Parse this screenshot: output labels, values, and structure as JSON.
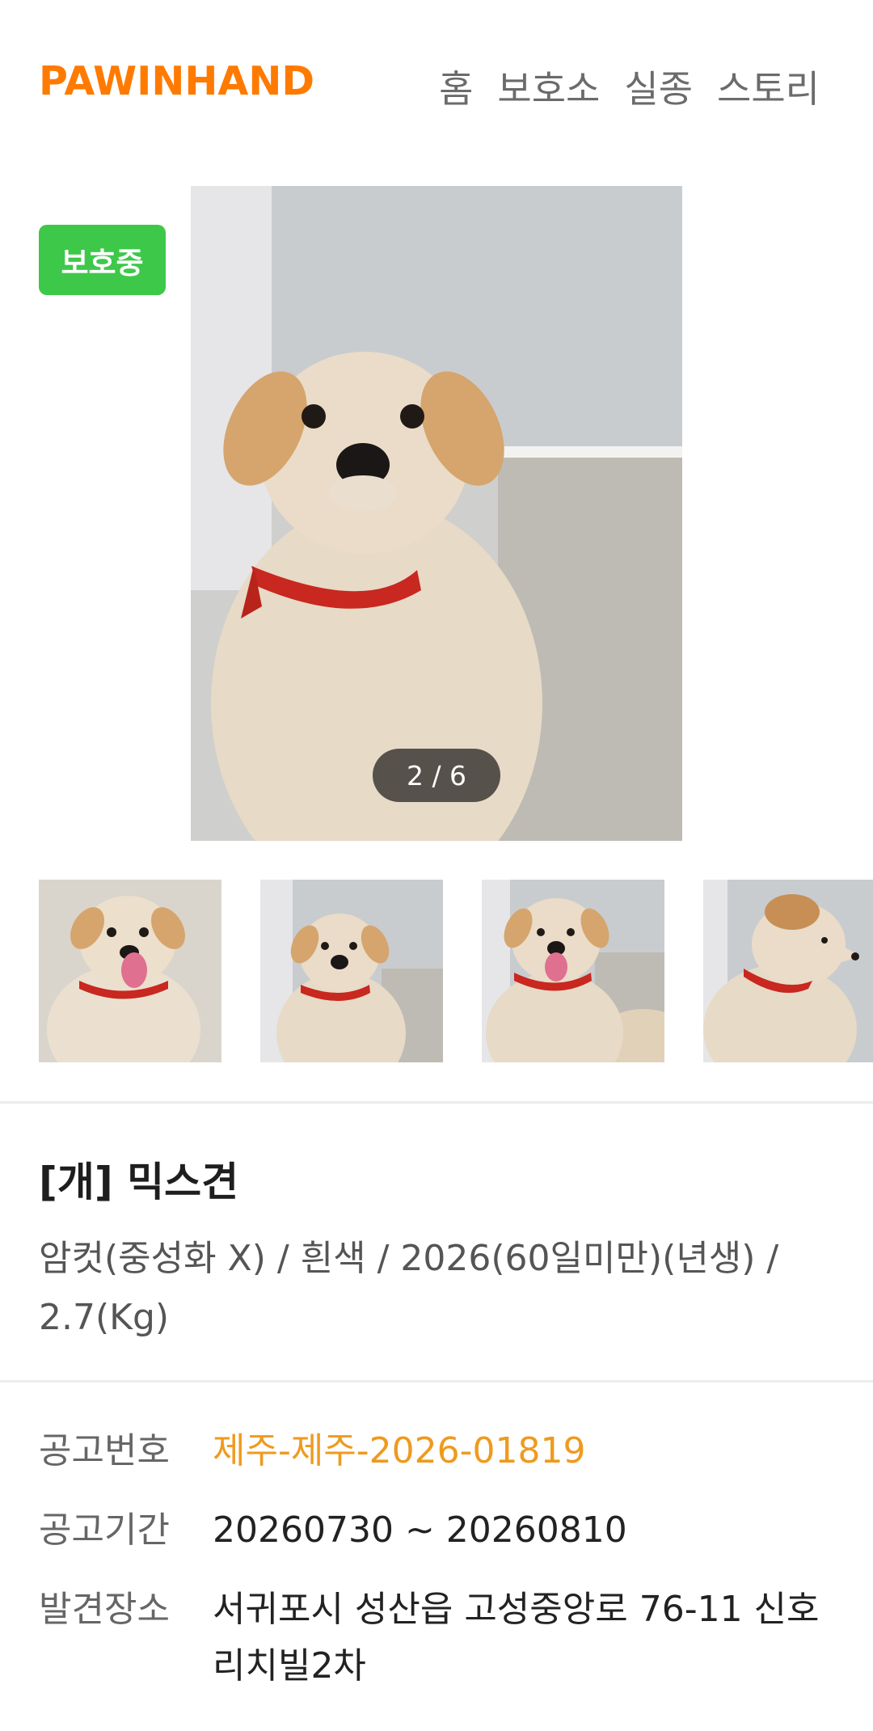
{
  "header": {
    "logo": "PAWINHAND",
    "nav": [
      "홈",
      "보호소",
      "실종",
      "스토리"
    ]
  },
  "status_badge": "보호중",
  "gallery": {
    "counter": "2 / 6",
    "thumbnail_count_visible": 4
  },
  "animal": {
    "title": "[개] 믹스견",
    "description": "암컷(중성화 X) / 흰색 / 2026(60일미만)(년생) / 2.7(Kg)"
  },
  "info": {
    "notice_no_label": "공고번호",
    "notice_no": "제주-제주-2026-01819",
    "period_label": "공고기간",
    "period": "20260730 ~ 20260810",
    "place_label": "발견장소",
    "place": "서귀포시 성산읍 고성중앙로 76-11 신호리치빌2차"
  },
  "colors": {
    "brand": "#ff7a00",
    "status_green": "#3ec84a",
    "accent_orange": "#ef9a1e"
  }
}
